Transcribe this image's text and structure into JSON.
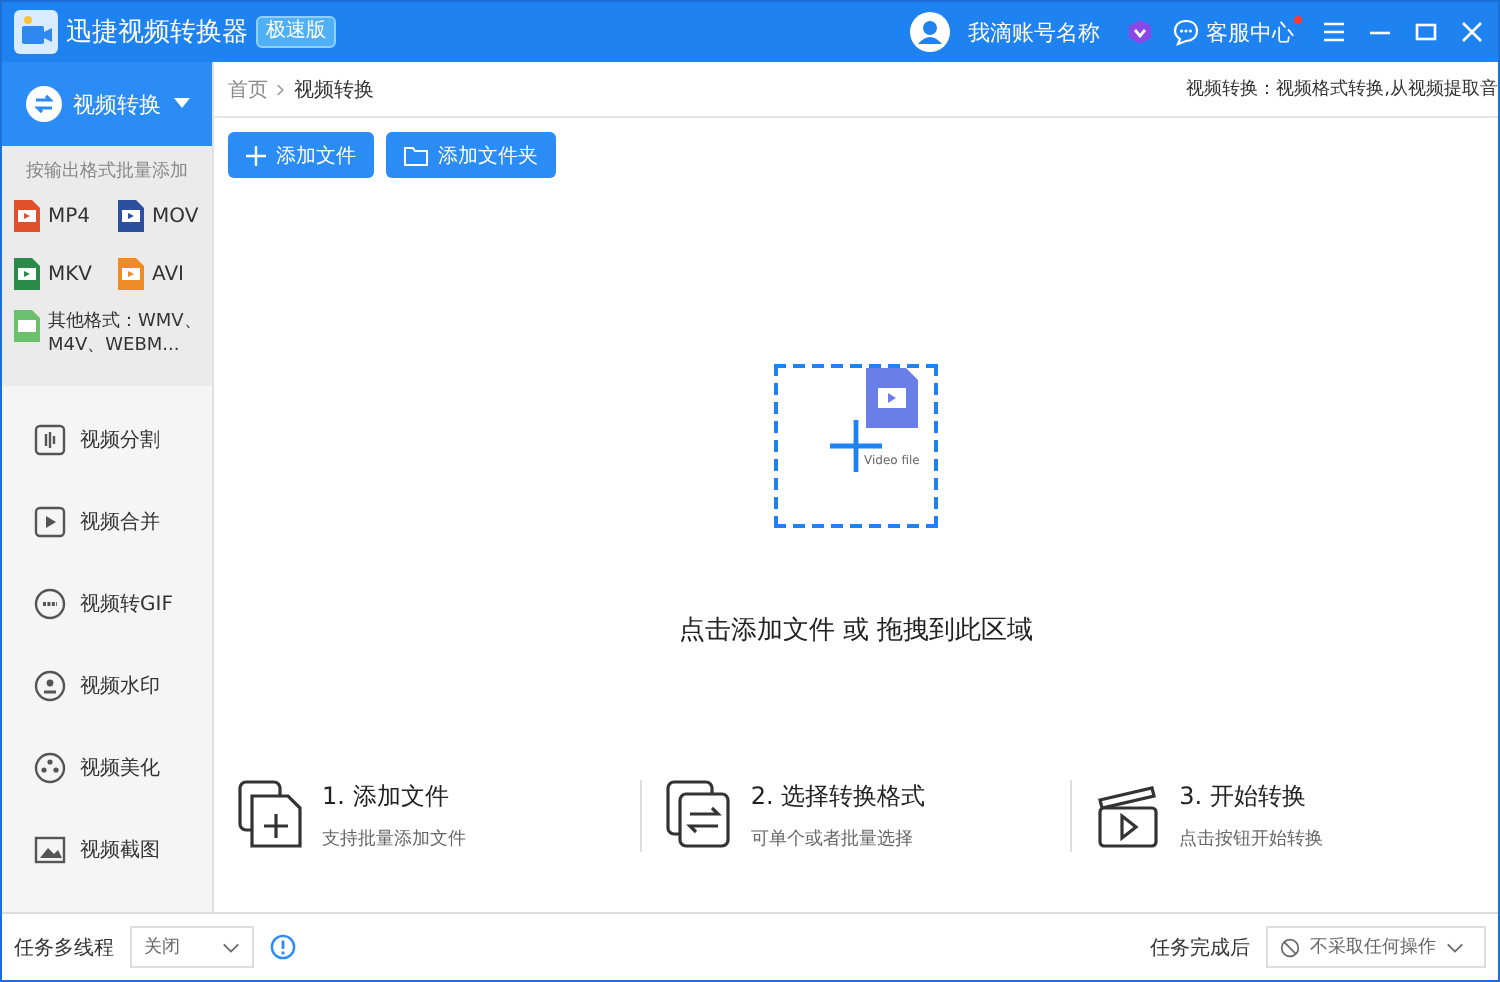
{
  "window": {
    "title": "迅捷视频转换器",
    "edition": "极速版",
    "account": "我滴账号名称",
    "support": {
      "label": "客服中心",
      "notification": true
    }
  },
  "sidebar": {
    "mode": "视频转换",
    "format_hint": "按输出格式批量添加",
    "formats": [
      {
        "label": "MP4",
        "color": "#e0502a"
      },
      {
        "label": "MOV",
        "color": "#2c4f9e"
      },
      {
        "label": "MKV",
        "color": "#2a8a4a"
      },
      {
        "label": "AVI",
        "color": "#f08a24"
      }
    ],
    "other_formats": {
      "label": "其他格式：WMV、M4V、WEBM...",
      "color": "#6cbf6c"
    },
    "tools": [
      {
        "label": "视频分割",
        "kind": "split"
      },
      {
        "label": "视频合并",
        "kind": "merge"
      },
      {
        "label": "视频转GIF",
        "kind": "gif"
      },
      {
        "label": "视频水印",
        "kind": "watermark"
      },
      {
        "label": "视频美化",
        "kind": "beautify"
      },
      {
        "label": "视频截图",
        "kind": "screenshot"
      }
    ]
  },
  "breadcrumb": [
    "首页",
    "视频转换"
  ],
  "description": "视频转换：视频格式转换,从视频提取音",
  "buttons": [
    {
      "label": "添加文件",
      "kind": "file"
    },
    {
      "label": "添加文件夹",
      "kind": "folder"
    }
  ],
  "dropzone": {
    "file_label": "Video file",
    "text": "点击添加文件 或 拖拽到此区域"
  },
  "steps": [
    {
      "title": "1. 添加文件",
      "subtitle": "支持批量添加文件",
      "kind": "add"
    },
    {
      "title": "2. 选择转换格式",
      "subtitle": "可单个或者批量选择",
      "kind": "convert"
    },
    {
      "title": "3. 开始转换",
      "subtitle": "点击按钮开始转换",
      "kind": "start"
    }
  ],
  "status_bar": {
    "multithread_label": "任务多线程",
    "multithread_value": "关闭",
    "after_label": "任务完成后",
    "after_value": "不采取任何操作"
  }
}
